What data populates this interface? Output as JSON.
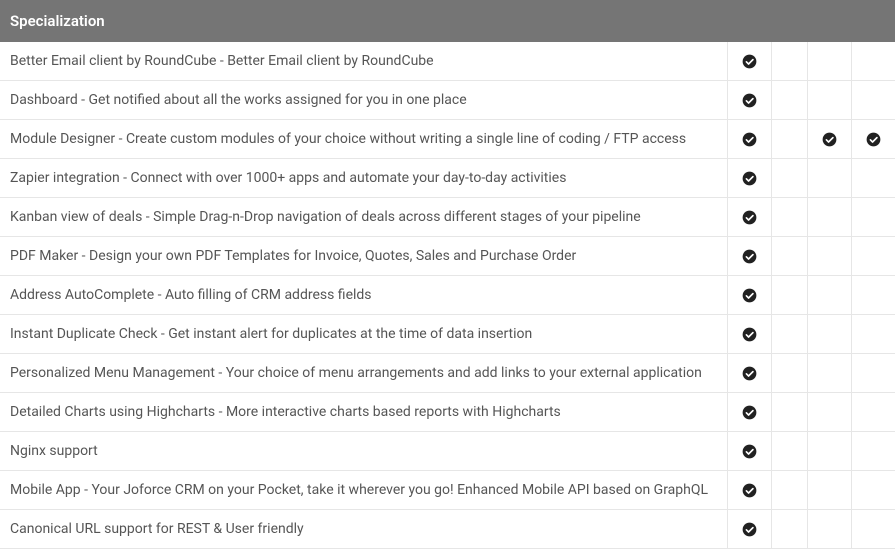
{
  "header": {
    "title": "Specialization"
  },
  "columns": [
    "c1",
    "c2",
    "c3",
    "c4"
  ],
  "rows": [
    {
      "label": "Better Email client by RoundCube - Better Email client by RoundCube",
      "checks": [
        true,
        false,
        false,
        false
      ]
    },
    {
      "label": "Dashboard - Get notified about all the works assigned for you in one place",
      "checks": [
        true,
        false,
        false,
        false
      ]
    },
    {
      "label": "Module Designer - Create custom modules of your choice without writing a single line of coding / FTP access",
      "checks": [
        true,
        false,
        true,
        true
      ]
    },
    {
      "label": "Zapier integration - Connect with over 1000+ apps and automate your day-to-day activities",
      "checks": [
        true,
        false,
        false,
        false
      ]
    },
    {
      "label": "Kanban view of deals - Simple Drag-n-Drop navigation of deals across different stages of your pipeline",
      "checks": [
        true,
        false,
        false,
        false
      ]
    },
    {
      "label": "PDF Maker - Design your own PDF Templates for Invoice, Quotes, Sales and Purchase Order",
      "checks": [
        true,
        false,
        false,
        false
      ]
    },
    {
      "label": "Address AutoComplete - Auto filling of CRM address fields",
      "checks": [
        true,
        false,
        false,
        false
      ]
    },
    {
      "label": "Instant Duplicate Check - Get instant alert for duplicates at the time of data insertion",
      "checks": [
        true,
        false,
        false,
        false
      ]
    },
    {
      "label": "Personalized Menu Management - Your choice of menu arrangements and add links to your external application",
      "checks": [
        true,
        false,
        false,
        false
      ]
    },
    {
      "label": "Detailed Charts using Highcharts - More interactive charts based reports with Highcharts",
      "checks": [
        true,
        false,
        false,
        false
      ]
    },
    {
      "label": "Nginx support",
      "checks": [
        true,
        false,
        false,
        false
      ]
    },
    {
      "label": "Mobile App - Your Joforce CRM on your Pocket, take it wherever you go! Enhanced Mobile API based on GraphQL",
      "checks": [
        true,
        false,
        false,
        false
      ]
    },
    {
      "label": "Canonical URL support for REST & User friendly",
      "checks": [
        true,
        false,
        false,
        false
      ]
    }
  ]
}
